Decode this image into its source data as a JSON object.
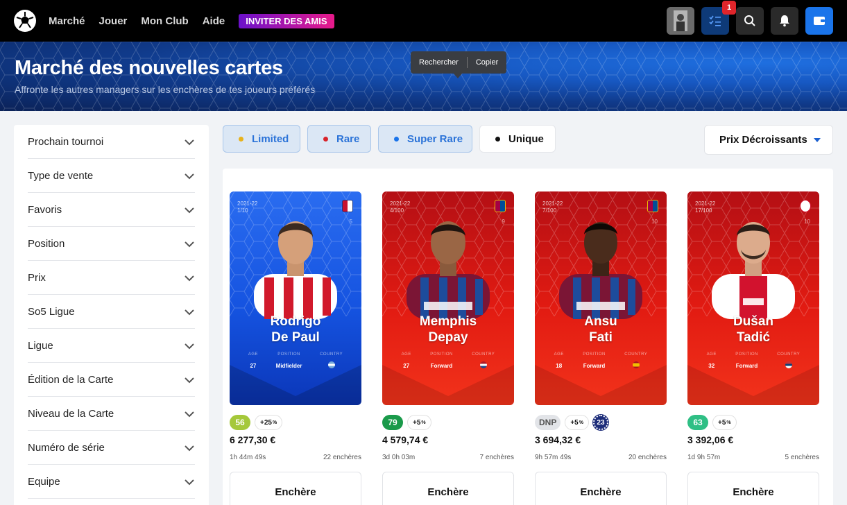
{
  "nav": {
    "links": [
      "Marché",
      "Jouer",
      "Mon Club",
      "Aide"
    ],
    "invite_label": "INVITER DES AMIS",
    "task_count": "1"
  },
  "hero": {
    "title": "Marché des nouvelles cartes",
    "subtitle": "Affronte les autres managers sur les enchères de tes joueurs préférés"
  },
  "tooltip": {
    "search": "Rechercher",
    "copy": "Copier"
  },
  "filters": [
    "Prochain tournoi",
    "Type de vente",
    "Favoris",
    "Position",
    "Prix",
    "So5 Ligue",
    "Ligue",
    "Édition de la Carte",
    "Niveau de la Carte",
    "Numéro de série",
    "Equipe"
  ],
  "rarity_tabs": [
    {
      "label": "Limited",
      "color": "#e8b21b"
    },
    {
      "label": "Rare",
      "color": "#d8232a"
    },
    {
      "label": "Super Rare",
      "color": "#1a74ea"
    },
    {
      "label": "Unique",
      "color": "#111111"
    }
  ],
  "sort_label": "Prix Décroissants",
  "cards": [
    {
      "season": "2021-22",
      "serial": "1/10",
      "jersey": "5",
      "name_line1": "Rodrigo",
      "name_line2": "De Paul",
      "age_label": "AGE",
      "position_label": "POSITION",
      "country_label": "COUNTRY",
      "age": "27",
      "position": "Midfielder",
      "score": "56",
      "score_color": "#a5c83a",
      "bonus": "+25",
      "bonus_unit": "%",
      "price": "6 277,30 €",
      "time_left": "1h 44m 49s",
      "bids": "22 enchères",
      "bid_label": "Enchère"
    },
    {
      "season": "2021-22",
      "serial": "4/100",
      "jersey": "9",
      "name_line1": "Memphis",
      "name_line2": "Depay",
      "age_label": "AGE",
      "position_label": "POSITION",
      "country_label": "COUNTRY",
      "age": "27",
      "position": "Forward",
      "score": "79",
      "score_color": "#1a9a4a",
      "bonus": "+5",
      "bonus_unit": "%",
      "price": "4 579,74 €",
      "time_left": "3d 0h 03m",
      "bids": "7 enchères",
      "bid_label": "Enchère"
    },
    {
      "season": "2021-22",
      "serial": "7/100",
      "jersey": "10",
      "name_line1": "Ansu",
      "name_line2": "Fati",
      "age_label": "AGE",
      "position_label": "POSITION",
      "country_label": "COUNTRY",
      "age": "18",
      "position": "Forward",
      "score": "DNP",
      "score_color": "#e2e4e8",
      "bonus": "+5",
      "bonus_unit": "%",
      "extra": "23",
      "price": "3 694,32 €",
      "time_left": "9h 57m 49s",
      "bids": "20 enchères",
      "bid_label": "Enchère"
    },
    {
      "season": "2021-22",
      "serial": "17/100",
      "jersey": "10",
      "name_line1": "Dušan",
      "name_line2": "Tadić",
      "age_label": "AGE",
      "position_label": "POSITION",
      "country_label": "COUNTRY",
      "age": "32",
      "position": "Forward",
      "score": "63",
      "score_color": "#2fbf85",
      "bonus": "+5",
      "bonus_unit": "%",
      "price": "3 392,06 €",
      "time_left": "1d 9h 57m",
      "bids": "5 enchères",
      "bid_label": "Enchère"
    }
  ]
}
